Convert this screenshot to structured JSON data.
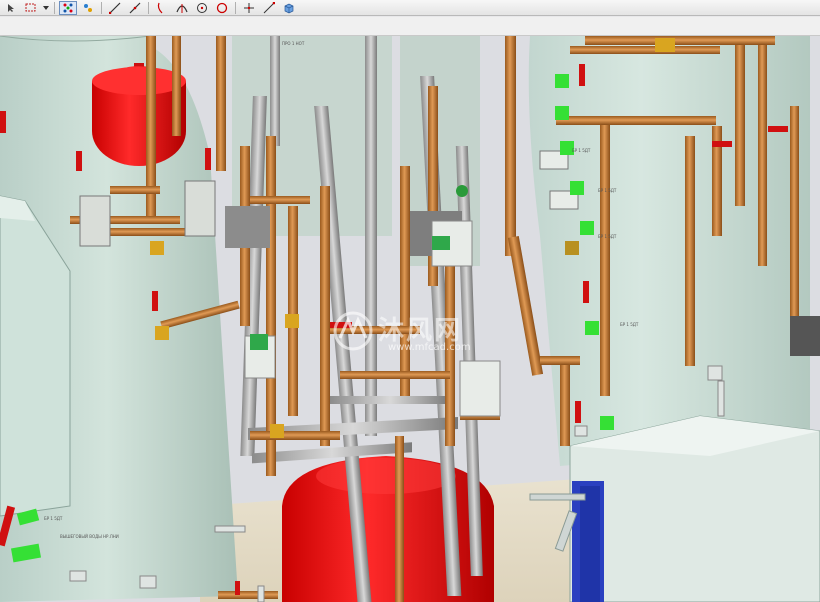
{
  "toolbar": {
    "buttons": [
      {
        "icon": "select-arrow-icon"
      },
      {
        "icon": "box-select-icon"
      },
      {
        "icon": "dropdown-arrow-icon"
      },
      {
        "icon": "snap-grid-icon"
      },
      {
        "icon": "snap-points-icon"
      },
      {
        "icon": "line-icon"
      },
      {
        "icon": "diagonal-line-icon"
      },
      {
        "icon": "arc-icon"
      },
      {
        "icon": "tangent-arc-icon"
      },
      {
        "icon": "circle-center-icon"
      },
      {
        "icon": "circle-point-icon"
      },
      {
        "icon": "crosshair-icon"
      },
      {
        "icon": "angle-line-icon"
      },
      {
        "icon": "box-view-icon"
      }
    ]
  },
  "viewport": {
    "watermark": {
      "main": "沐风网",
      "url": "www.mfcad.com"
    },
    "labels": {
      "left_tank_label": "ВЫШЕГОВЫЙ ВОДЫ НР.ЛНИ",
      "pipe_label_a": "ПРО 1 НОТ",
      "tag_a": "БР 1 5ДТ",
      "tag_b": "БР 1 5ДТ",
      "tag_c": "БР 1 5ДТ",
      "tag_d": "БР 1 5ДТ",
      "tag_e": "БР 1 5ДТ"
    }
  }
}
